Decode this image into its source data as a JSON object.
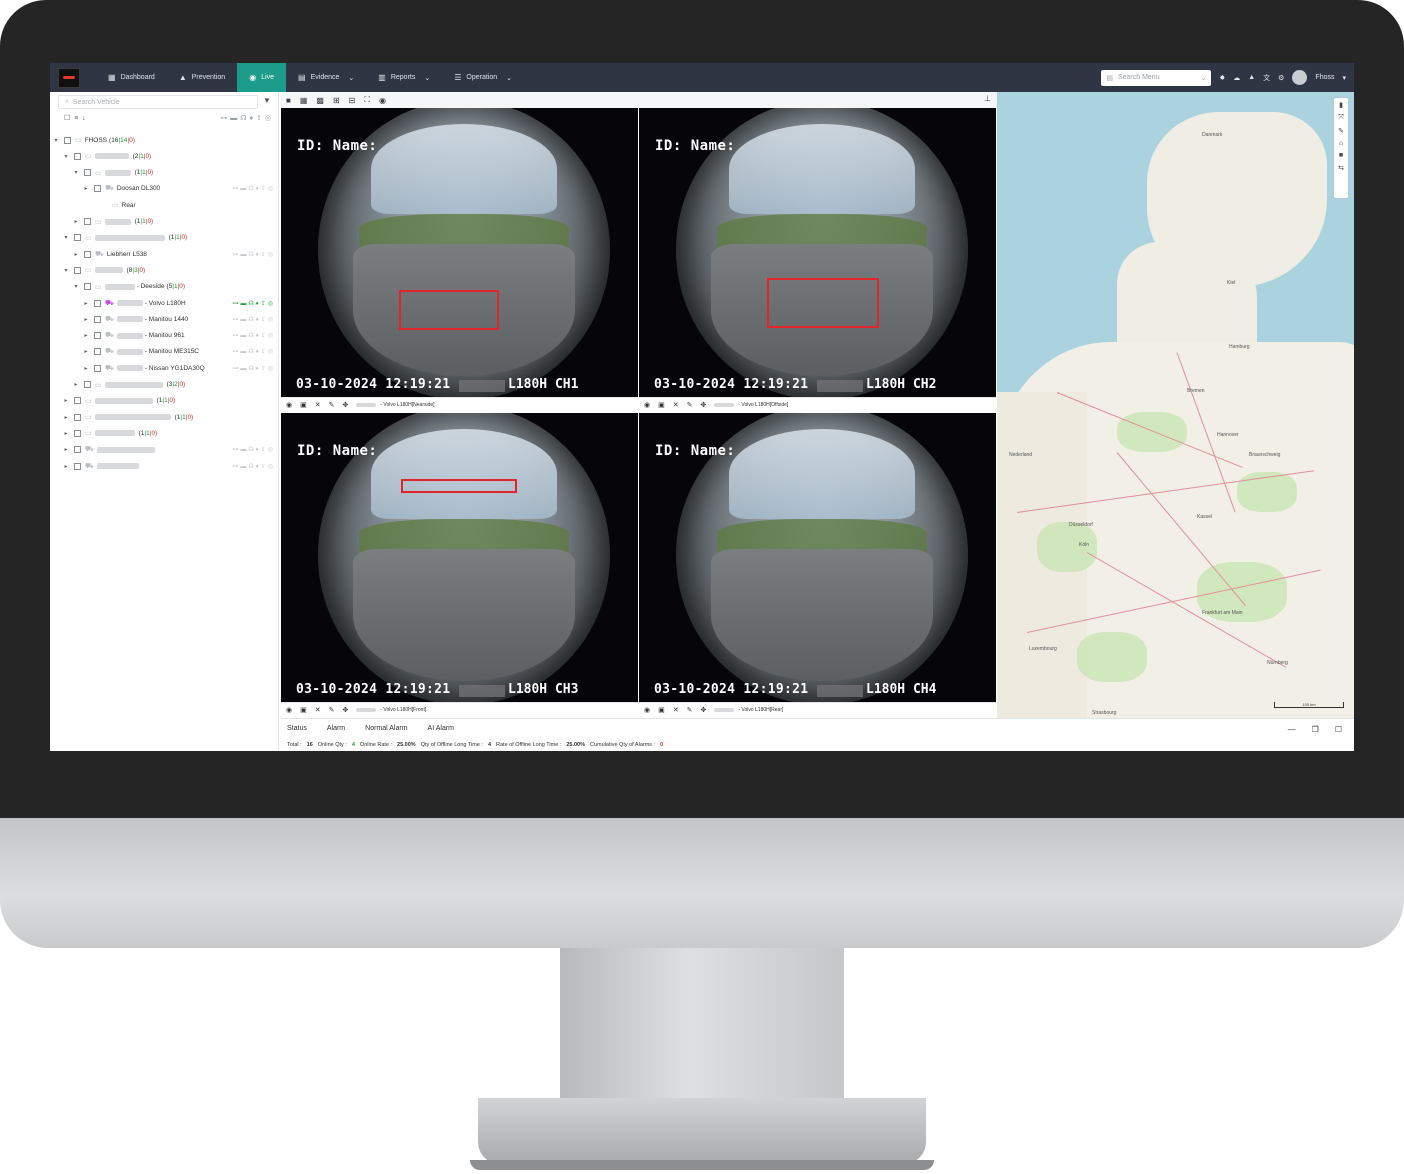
{
  "nav": {
    "items": [
      {
        "label": "Dashboard",
        "icon": "dashboard-icon",
        "glyph": "▦"
      },
      {
        "label": "Prevention",
        "icon": "warning-icon",
        "glyph": "▲"
      },
      {
        "label": "Live",
        "icon": "live-icon",
        "glyph": "◉"
      },
      {
        "label": "Evidence",
        "icon": "folder-icon",
        "glyph": "▤"
      },
      {
        "label": "Reports",
        "icon": "chart-icon",
        "glyph": "▥"
      },
      {
        "label": "Operation",
        "icon": "sliders-icon",
        "glyph": "☰"
      }
    ],
    "search_placeholder": "Search Menu",
    "user_name": "Fhoss",
    "accent": "#1d9c8c"
  },
  "sidebar": {
    "search_placeholder": "Search Vehicle",
    "tree": [
      {
        "level": 0,
        "name": "FHOSS",
        "count": "(16",
        "online": "14",
        "offline": "0)",
        "blurw": 0
      },
      {
        "level": 1,
        "name": "",
        "count": "(2",
        "online": "1",
        "offline": "0)",
        "blurw": 34
      },
      {
        "level": 2,
        "name": "",
        "count": "(1",
        "online": "1",
        "offline": "0)",
        "blurw": 26
      },
      {
        "level": 3,
        "name": "Doosan DL300",
        "count": "",
        "online": "",
        "offline": "",
        "blurw": 0,
        "icons": true
      },
      {
        "level": 4,
        "name": "Rear",
        "count": "",
        "online": "",
        "offline": "",
        "blurw": 0
      },
      {
        "level": 2,
        "name": "",
        "count": "(1",
        "online": "1",
        "offline": "0)",
        "blurw": 26
      },
      {
        "level": 1,
        "name": "",
        "count": "(1",
        "online": "1",
        "offline": "0)",
        "blurw": 70
      },
      {
        "level": 2,
        "name": "Liebherr L538",
        "count": "",
        "online": "",
        "offline": "",
        "blurw": 0,
        "icons": true
      },
      {
        "level": 1,
        "name": "",
        "count": "(8",
        "online": "3",
        "offline": "0)",
        "blurw": 28
      },
      {
        "level": 2,
        "name": "- Deeside",
        "count": "(5",
        "online": "1",
        "offline": "0)",
        "blurw": 30
      },
      {
        "level": 3,
        "name": "- Volvo L180H",
        "count": "",
        "online": "",
        "offline": "",
        "blurw": 26,
        "icons": true,
        "live": true
      },
      {
        "level": 3,
        "name": "- Manitou 1440",
        "count": "",
        "online": "",
        "offline": "",
        "blurw": 26,
        "icons": true
      },
      {
        "level": 3,
        "name": "- Manitou 961",
        "count": "",
        "online": "",
        "offline": "",
        "blurw": 26,
        "icons": true
      },
      {
        "level": 3,
        "name": "- Manitou ME315C",
        "count": "",
        "online": "",
        "offline": "",
        "blurw": 26,
        "icons": true
      },
      {
        "level": 3,
        "name": "- Nissan YG1DA30Q",
        "count": "",
        "online": "",
        "offline": "",
        "blurw": 26,
        "icons": true
      },
      {
        "level": 2,
        "name": "",
        "count": "(3",
        "online": "2",
        "offline": "0)",
        "blurw": 58
      },
      {
        "level": 1,
        "name": "",
        "count": "(1",
        "online": "1",
        "offline": "0)",
        "blurw": 58
      },
      {
        "level": 1,
        "name": "",
        "count": "(1",
        "online": "1",
        "offline": "0)",
        "blurw": 76
      },
      {
        "level": 1,
        "name": "",
        "count": "(1",
        "online": "1",
        "offline": "0)",
        "blurw": 40
      },
      {
        "level": 1,
        "name": "",
        "count": "",
        "online": "",
        "offline": "",
        "blurw": 58,
        "icons": true
      },
      {
        "level": 1,
        "name": "",
        "count": "",
        "online": "",
        "offline": "",
        "blurw": 42,
        "icons": true
      }
    ]
  },
  "videos": [
    {
      "id_label": "ID: Name:",
      "timestamp": "03-10-2024 12:19:21",
      "channel": "L180H CH1",
      "caption": "- Volvo L180H[Nearside]"
    },
    {
      "id_label": "ID: Name:",
      "timestamp": "03-10-2024 12:19:21",
      "channel": "L180H CH2",
      "caption": "- Volvo L180H[Offside]"
    },
    {
      "id_label": "ID: Name:",
      "timestamp": "03-10-2024 12:19:21",
      "channel": "L180H CH3",
      "caption": "- Volvo L180H[Front]"
    },
    {
      "id_label": "ID: Name:",
      "timestamp": "03-10-2024 12:19:21",
      "channel": "L180H CH4",
      "caption": "- Volvo L180H[Rear]"
    }
  ],
  "map": {
    "cities": [
      {
        "name": "Danmark"
      },
      {
        "name": "Kiel"
      },
      {
        "name": "Hamburg"
      },
      {
        "name": "Bremen"
      },
      {
        "name": "Hannover"
      },
      {
        "name": "Nederland"
      },
      {
        "name": "Düsseldorf"
      },
      {
        "name": "Köln"
      },
      {
        "name": "Frankfurt am Main"
      },
      {
        "name": "Luxembourg"
      },
      {
        "name": "Nürnberg"
      },
      {
        "name": "Strasbourg"
      },
      {
        "name": "Kassel"
      },
      {
        "name": "Braunschweig"
      }
    ],
    "scale": "100 km"
  },
  "bottom": {
    "tabs": [
      "Status",
      "Alarm",
      "Normal Alarm",
      "AI Alarm"
    ],
    "stats": {
      "total_label": "Total :",
      "total": "16",
      "online_label": "Online Qty :",
      "online": "4",
      "rate_label": "Online Rate :",
      "rate": "25.00%",
      "offline_long_label": "Qty of Offline Long Time :",
      "offline_long": "4",
      "offline_rate_label": "Rate of Offline Long Time :",
      "offline_rate": "25.00%",
      "alarms_label": "Cumulative Qty of Alarms :",
      "alarms": "0"
    }
  }
}
